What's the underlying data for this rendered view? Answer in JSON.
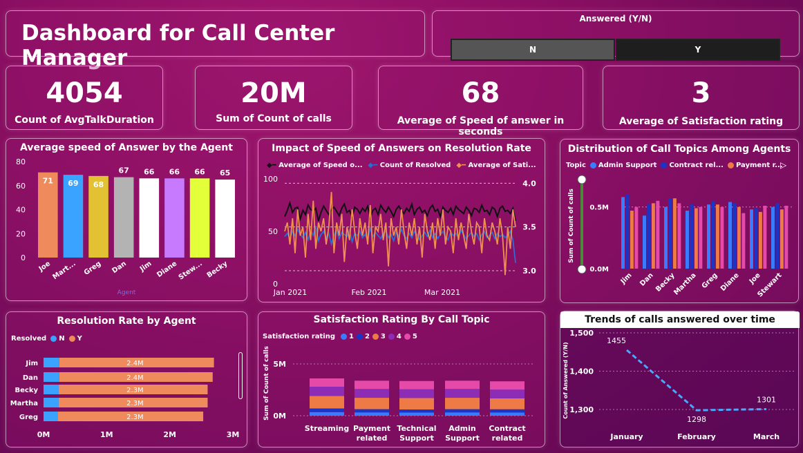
{
  "title": "Dashboard for Call Center Manager",
  "slicer": {
    "label": "Answered (Y/N)",
    "options": [
      "N",
      "Y"
    ]
  },
  "kpis": [
    {
      "value": "4054",
      "label": "Count of AvgTalkDuration"
    },
    {
      "value": "20M",
      "label": "Sum of Count of calls"
    },
    {
      "value": "68",
      "label": "Average of Speed of answer in seconds"
    },
    {
      "value": "3",
      "label": "Average of Satisfaction rating"
    }
  ],
  "colors": {
    "orange": "#ee8a5c",
    "blue": "#3aa3ff",
    "darkblue": "#1533c4",
    "pink": "#e64aa8",
    "purple": "#8d2db6"
  },
  "chart_data": [
    {
      "type": "bar",
      "title": "Average speed of Answer by the Agent",
      "xlabel": "Agent",
      "categories": [
        "Joe",
        "Mart...",
        "Greg",
        "Dan",
        "Jim",
        "Diane",
        "Stew...",
        "Becky"
      ],
      "values": [
        71,
        69,
        68,
        67,
        66,
        66,
        66,
        65
      ],
      "colors": [
        "#ee8a5c",
        "#3aa3ff",
        "#e2c132",
        "#b3b3b3",
        "#ffffff",
        "#c87aff",
        "#e3ff3a",
        "#ffffff"
      ],
      "ylim": [
        0,
        80
      ],
      "yticks": [
        0,
        20,
        40,
        60,
        80
      ]
    },
    {
      "type": "line",
      "title": "Impact of Speed of Answers on Resolution Rate",
      "legend": [
        "Average of Speed o...",
        "Count of Resolved",
        "Average of Sati..."
      ],
      "xticks": [
        "Jan 2021",
        "Feb 2021",
        "Mar 2021"
      ],
      "yticks_left": [
        0,
        50,
        100
      ],
      "yticks_right": [
        "3.0",
        "3.5",
        "4.0"
      ],
      "series": [
        {
          "name": "Average of Speed o...",
          "color": "#111111",
          "values": [
            64,
            70,
            77,
            68,
            72,
            73,
            62,
            70,
            66,
            75,
            71,
            69,
            72,
            60,
            68,
            74,
            70,
            66,
            71,
            73,
            69,
            65,
            72,
            76,
            68,
            70,
            64,
            73,
            71,
            67,
            72,
            69,
            74,
            63,
            70,
            72,
            66,
            75,
            71,
            68,
            73,
            69,
            64,
            71,
            74,
            70,
            67,
            72,
            69,
            76,
            66,
            71,
            73,
            68,
            70,
            65,
            72,
            75,
            69,
            71,
            64,
            73,
            70,
            68,
            72,
            66,
            74,
            71,
            69,
            67,
            73,
            70,
            65,
            72,
            71,
            68,
            75,
            69,
            70,
            66,
            73,
            71,
            64,
            72,
            74,
            69,
            70,
            67,
            72,
            60
          ]
        },
        {
          "name": "Count of Resolved",
          "color": "#2a6fd1",
          "values": [
            45,
            48,
            43,
            50,
            46,
            52,
            47,
            44,
            49,
            42,
            51,
            46,
            55,
            41,
            47,
            50,
            44,
            48,
            38,
            46,
            52,
            43,
            49,
            47,
            45,
            51,
            40,
            48,
            46,
            50,
            44,
            47,
            42,
            53,
            45,
            49,
            46,
            43,
            48,
            50,
            44,
            47,
            41,
            49,
            45,
            52,
            46,
            43,
            48,
            44,
            50,
            47,
            42,
            46,
            49,
            45,
            51,
            44,
            48,
            43,
            47,
            50,
            45,
            42,
            49,
            46,
            48,
            44,
            51,
            47,
            43,
            46,
            49,
            45,
            48,
            42,
            47,
            50,
            44,
            46,
            49,
            43,
            48,
            45,
            47,
            44,
            46,
            50,
            42,
            20
          ]
        },
        {
          "name": "Average of Sati...",
          "color": "#f09050",
          "values": [
            3.45,
            3.55,
            3.3,
            3.6,
            3.2,
            3.7,
            3.4,
            3.5,
            3.15,
            3.65,
            3.35,
            3.8,
            3.25,
            3.55,
            3.45,
            3.6,
            3.3,
            3.5,
            3.9,
            3.2,
            3.55,
            3.4,
            3.65,
            3.1,
            3.5,
            3.35,
            3.7,
            3.45,
            3.25,
            3.6,
            3.4,
            3.55,
            3.3,
            3.75,
            3.2,
            3.5,
            3.45,
            3.65,
            3.35,
            3.55,
            3.05,
            3.6,
            3.4,
            3.5,
            3.3,
            3.7,
            3.45,
            3.25,
            3.55,
            3.4,
            3.6,
            3.3,
            3.5,
            3.15,
            3.65,
            3.45,
            3.35,
            3.55,
            3.25,
            3.6,
            3.4,
            3.7,
            3.3,
            3.5,
            3.45,
            3.2,
            3.6,
            3.35,
            3.55,
            3.4,
            3.25,
            3.65,
            3.45,
            3.3,
            3.55,
            3.5,
            3.2,
            3.6,
            3.4,
            3.35,
            3.55,
            3.45,
            3.3,
            3.6,
            3.4,
            2.95,
            3.5,
            3.25,
            3.7,
            3.5
          ]
        }
      ]
    },
    {
      "type": "bar",
      "title": "Distribution of Call Topics Among Agents",
      "legend_title": "Topic",
      "legend": [
        {
          "name": "Admin Support",
          "color": "#3a7cff"
        },
        {
          "name": "Contract rel...",
          "color": "#1a34c8"
        },
        {
          "name": "Payment r...",
          "color": "#ee7a45"
        }
      ],
      "ylabel": "Sum of Count of calls",
      "yticks": [
        "0.0M",
        "0.5M"
      ],
      "categories": [
        "Jim",
        "Dan",
        "Becky",
        "Martha",
        "Greg",
        "Diane",
        "Joe",
        "Stewart"
      ],
      "series": [
        {
          "color": "#3a7cff",
          "values": [
            0.58,
            0.43,
            0.5,
            0.47,
            0.52,
            0.54,
            0.48,
            0.5
          ]
        },
        {
          "color": "#1a34c8",
          "values": [
            0.6,
            0.52,
            0.57,
            0.52,
            0.55,
            0.53,
            0.49,
            0.53
          ]
        },
        {
          "color": "#ee7a45",
          "values": [
            0.47,
            0.53,
            0.57,
            0.49,
            0.52,
            0.5,
            0.46,
            0.48
          ]
        },
        {
          "color": "#e64aa8",
          "values": [
            0.5,
            0.55,
            0.53,
            0.5,
            0.5,
            0.45,
            0.51,
            0.51
          ]
        }
      ],
      "ylim": [
        0,
        0.7
      ]
    },
    {
      "type": "bar",
      "title": "Resolution Rate by Agent",
      "legend_title": "Resolved",
      "legend": [
        {
          "name": "N",
          "color": "#3aa3ff"
        },
        {
          "name": "Y",
          "color": "#ee8a5c"
        }
      ],
      "categories": [
        "Jim",
        "Dan",
        "Becky",
        "Martha",
        "Greg"
      ],
      "series": [
        {
          "name": "N",
          "color": "#3aa3ff",
          "values": [
            0.25,
            0.25,
            0.24,
            0.24,
            0.23
          ]
        },
        {
          "name": "Y",
          "color": "#ee8a5c",
          "values": [
            2.45,
            2.43,
            2.36,
            2.36,
            2.3
          ]
        }
      ],
      "data_labels": [
        "2.4M",
        "2.4M",
        "2.3M",
        "2.3M",
        "2.3M"
      ],
      "xticks": [
        "0M",
        "1M",
        "2M",
        "3M"
      ],
      "xlim": [
        0,
        3
      ]
    },
    {
      "type": "bar",
      "title": "Satisfaction Rating By Call Topic",
      "legend_title": "Satisfaction rating",
      "legend": [
        {
          "name": "1",
          "color": "#3a7cff"
        },
        {
          "name": "2",
          "color": "#1a34c8"
        },
        {
          "name": "3",
          "color": "#ee7a45"
        },
        {
          "name": "4",
          "color": "#8d2db6"
        },
        {
          "name": "5",
          "color": "#e64aa8"
        }
      ],
      "ylabel": "Sum of Count of calls",
      "yticks": [
        "0M",
        "5M"
      ],
      "categories": [
        "Streaming",
        "Payment related",
        "Technical Support",
        "Admin Support",
        "Contract related"
      ],
      "series": [
        {
          "name": "1",
          "values": [
            0.35,
            0.32,
            0.3,
            0.32,
            0.31
          ]
        },
        {
          "name": "2",
          "values": [
            0.35,
            0.31,
            0.3,
            0.31,
            0.31
          ]
        },
        {
          "name": "3",
          "values": [
            1.2,
            1.1,
            1.1,
            1.1,
            1.05
          ]
        },
        {
          "name": "4",
          "values": [
            0.9,
            0.85,
            0.85,
            0.85,
            0.85
          ]
        },
        {
          "name": "5",
          "values": [
            0.8,
            0.8,
            0.8,
            0.8,
            0.8
          ]
        }
      ],
      "ylim": [
        0,
        6
      ]
    },
    {
      "type": "line",
      "title": "Trends of calls answered over time",
      "ylabel": "Count of Answered (Y/N)",
      "categories": [
        "January",
        "February",
        "March"
      ],
      "values": [
        1455,
        1298,
        1301
      ],
      "yticks": [
        "1,300",
        "1,400",
        "1,500"
      ],
      "ylim": [
        1300,
        1500
      ]
    }
  ]
}
